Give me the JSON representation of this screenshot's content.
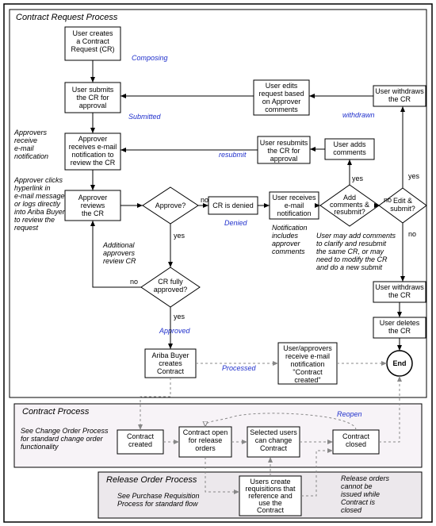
{
  "titles": {
    "crp": "Contract Request Process",
    "cp": "Contract Process",
    "rop": "Release Order Process"
  },
  "nodes": {
    "n1": "User creates\na Contract\nRequest (CR)",
    "n2": "User submits\nthe CR for\napproval",
    "n3": "Approver\nreceives e-mail\nnotification to\nreview the CR",
    "n4": "Approver\nreviews\nthe CR",
    "d1": "Approve?",
    "n5": "CR is denied",
    "n6": "User receives\ne-mail\nnotification",
    "d2": "Add\ncomments &\nresubmit?",
    "n7": "User adds\ncomments",
    "n8": "User resubmits\nthe CR for\napproval",
    "n9": "User edits\nrequest based\non Approver\ncomments",
    "d3": "Edit &\nsubmit?",
    "n10": "User withdraws\nthe CR",
    "n11": "User withdraws\nthe CR",
    "n12": "User deletes\nthe CR",
    "d4": "CR fully\napproved?",
    "n13": "Ariba Buyer\ncreates\nContract",
    "n14": "User/approvers\nreceive e-mail\nnotification\n\"Contract\ncreated\"",
    "end": "End",
    "cp1": "Contract\ncreated",
    "cp2": "Contract open\nfor release\norders",
    "cp3": "Selected users\ncan change\nContract",
    "cp4": "Contract\nclosed",
    "rp1": "Users create\nrequisitions that\nreference and\nuse the\nContract"
  },
  "labels": {
    "composing": "Composing",
    "submitted": "Submitted",
    "resubmit": "resubmit",
    "withdrawn": "withdrawn",
    "denied": "Denied",
    "approved": "Approved",
    "processed": "Processed",
    "reopen": "Reopen"
  },
  "captions": {
    "c1": "Approvers\nreceive\ne-mail\nnotification",
    "c2": "Approver clicks\nhyperlink in\ne-mail message\nor logs directly\ninto Ariba Buyer\nto review the\nrequest",
    "c3": "Notification\nincludes\napprover\ncomments",
    "c4": "User may add comments\nto clarify and resubmit\nthe same CR, or may\nneed to modify the CR\nand do a new submit",
    "c5": "Additional\napprovers\nreview CR",
    "c6": "See Change Order Process\nfor standard change order\nfunctionality",
    "c7": "See Purchase Requisition\nProcess for standard flow",
    "c8": "Release orders\ncannot be\nissued while\nContract is\nclosed"
  },
  "yesno": {
    "y": "yes",
    "n": "no"
  }
}
